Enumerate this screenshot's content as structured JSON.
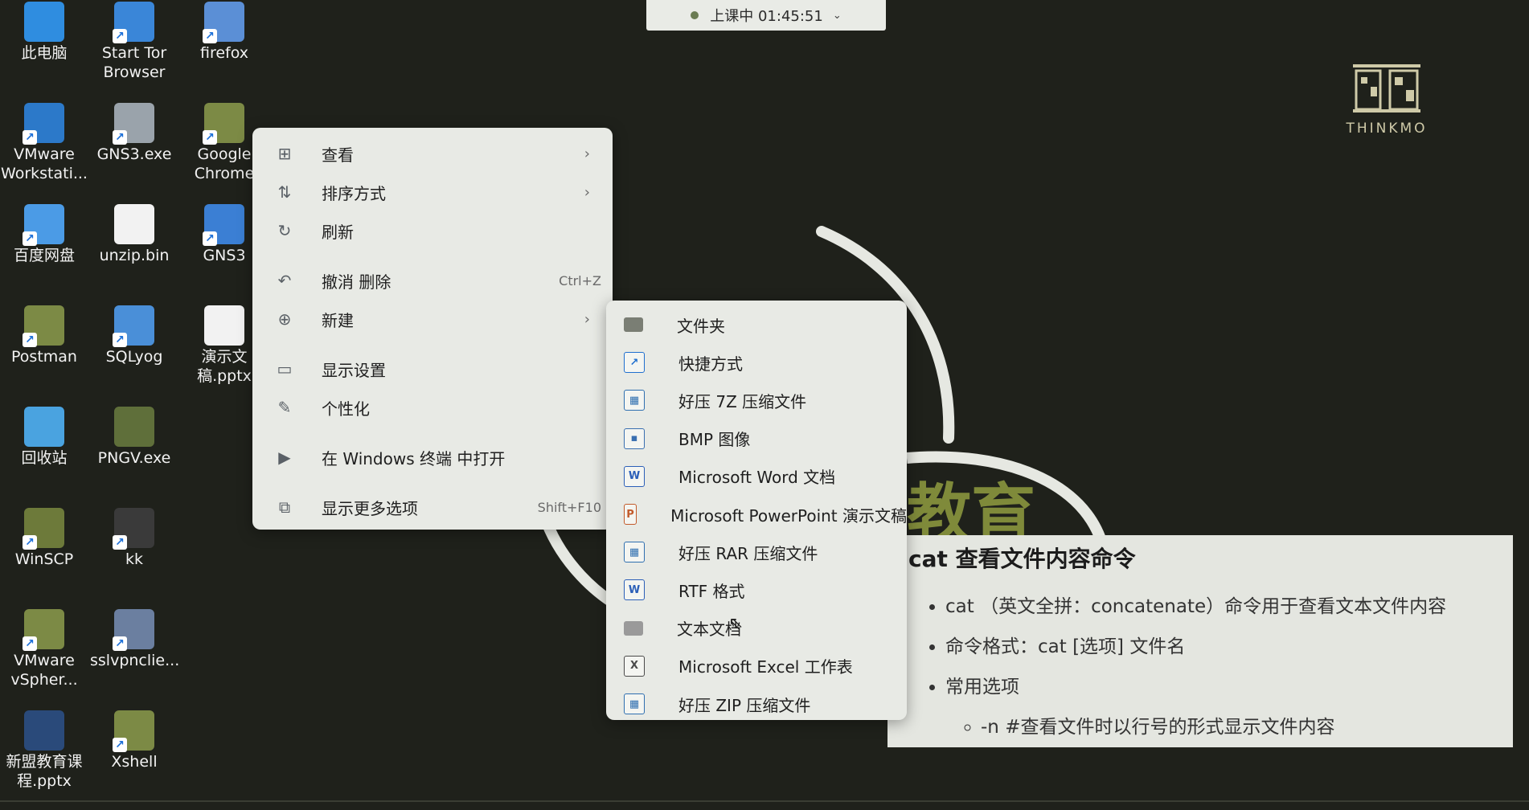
{
  "session": {
    "status": "上课中 01:45:51",
    "chevron_icon": "chevron-down-icon"
  },
  "logo": {
    "text": "THINKMO"
  },
  "background": {
    "big_text": "教育"
  },
  "desktop_icons": [
    {
      "label": "此电脑",
      "icon": "computer-icon",
      "color": "#2f8de0"
    },
    {
      "label": "Start Tor Browser",
      "icon": "tor-icon",
      "color": "#3a86d8"
    },
    {
      "label": "firefox",
      "icon": "firefox-icon",
      "color": "#5b8fd6"
    },
    {
      "label": "VMware Workstati...",
      "icon": "vmware-icon",
      "color": "#2c79c9"
    },
    {
      "label": "GNS3.exe",
      "icon": "gns3-exe-icon",
      "color": "#9aa3ab"
    },
    {
      "label": "Google Chrome",
      "icon": "chrome-icon",
      "color": "#7c8a45"
    },
    {
      "label": "百度网盘",
      "icon": "baidu-netdisk-icon",
      "color": "#4b9be6"
    },
    {
      "label": "unzip.bin",
      "icon": "file-icon",
      "color": "#f2f2f2"
    },
    {
      "label": "GNS3",
      "icon": "gns3-icon",
      "color": "#3b7fd4"
    },
    {
      "label": "Postman",
      "icon": "postman-icon",
      "color": "#7c8a45"
    },
    {
      "label": "SQLyog",
      "icon": "sqlyog-icon",
      "color": "#4a8fd8"
    },
    {
      "label": "演示文稿.pptx",
      "icon": "pptx-file-icon",
      "color": "#f2f2f2"
    },
    {
      "label": "回收站",
      "icon": "recycle-bin-icon",
      "color": "#4aa3e0"
    },
    {
      "label": "PNGV.exe",
      "icon": "pngv-icon",
      "color": "#5f6f3a"
    },
    {
      "label": "WinSCP",
      "icon": "winscp-icon",
      "color": "#6d7a3a"
    },
    {
      "label": "kk",
      "icon": "kk-icon",
      "color": "#3a3a3a"
    },
    {
      "label": "VMware vSpher...",
      "icon": "vsphere-icon",
      "color": "#7c8a45"
    },
    {
      "label": "sslvpnclie...",
      "icon": "sslvpn-icon",
      "color": "#6b7fa0"
    },
    {
      "label": "新盟教育课程.pptx",
      "icon": "pptx-thumbnail-icon",
      "color": "#2a4a7a"
    },
    {
      "label": "Xshell",
      "icon": "xshell-icon",
      "color": "#7c8a45"
    }
  ],
  "context_menu": {
    "items": [
      {
        "label": "查看",
        "icon": "view-grid-icon",
        "glyph": "⊞",
        "shortcut": "",
        "submenu": true
      },
      {
        "label": "排序方式",
        "icon": "sort-icon",
        "glyph": "⇅",
        "shortcut": "",
        "submenu": true
      },
      {
        "label": "刷新",
        "icon": "refresh-icon",
        "glyph": "↻",
        "shortcut": "",
        "submenu": false
      },
      {
        "label": "撤消 删除",
        "icon": "undo-icon",
        "glyph": "↶",
        "shortcut": "Ctrl+Z",
        "submenu": false
      },
      {
        "label": "新建",
        "icon": "new-plus-icon",
        "glyph": "⊕",
        "shortcut": "",
        "submenu": true
      },
      {
        "label": "显示设置",
        "icon": "display-settings-icon",
        "glyph": "▭",
        "shortcut": "",
        "submenu": false
      },
      {
        "label": "个性化",
        "icon": "brush-icon",
        "glyph": "✎",
        "shortcut": "",
        "submenu": false
      },
      {
        "label": "在 Windows 终端 中打开",
        "icon": "terminal-icon",
        "glyph": "▶",
        "shortcut": "",
        "submenu": false
      },
      {
        "label": "显示更多选项",
        "icon": "more-options-icon",
        "glyph": "⧉",
        "shortcut": "Shift+F10",
        "submenu": false
      }
    ],
    "arrow_glyph": "›"
  },
  "new_submenu": {
    "items": [
      {
        "label": "文件夹",
        "icon": "folder-icon",
        "glyph": "",
        "color": "#7a7e74"
      },
      {
        "label": "快捷方式",
        "icon": "shortcut-arrow-icon",
        "glyph": "↗",
        "color": "#1f6fcf"
      },
      {
        "label": "好压 7Z 压缩文件",
        "icon": "haozip-7z-icon",
        "glyph": "▦",
        "color": "#2f6fb0"
      },
      {
        "label": "BMP 图像",
        "icon": "bmp-image-icon",
        "glyph": "▪",
        "color": "#3a6fb0"
      },
      {
        "label": "Microsoft Word 文档",
        "icon": "word-doc-icon",
        "glyph": "W",
        "color": "#2b5fb8"
      },
      {
        "label": "Microsoft PowerPoint 演示文稿",
        "icon": "powerpoint-icon",
        "glyph": "P",
        "color": "#c25a2a"
      },
      {
        "label": "好压 RAR 压缩文件",
        "icon": "haozip-rar-icon",
        "glyph": "▦",
        "color": "#2f6fb0"
      },
      {
        "label": "RTF 格式",
        "icon": "rtf-doc-icon",
        "glyph": "W",
        "color": "#2b5fb8"
      },
      {
        "label": "文本文档",
        "icon": "text-doc-icon",
        "glyph": "",
        "color": "#9a9a9a"
      },
      {
        "label": "Microsoft Excel 工作表",
        "icon": "excel-icon",
        "glyph": "X",
        "color": "#4a4a4a"
      },
      {
        "label": "好压 ZIP 压缩文件",
        "icon": "haozip-zip-icon",
        "glyph": "▦",
        "color": "#2f6fb0"
      }
    ]
  },
  "slide": {
    "title": "cat 查看文件内容命令",
    "bullets": [
      "cat （英文全拼：concatenate）命令用于查看文本文件内容",
      "命令格式：cat [选项] 文件名",
      "常用选项"
    ],
    "sub_bullets": [
      "-n #查看文件时以行号的形式显示文件内容"
    ]
  }
}
